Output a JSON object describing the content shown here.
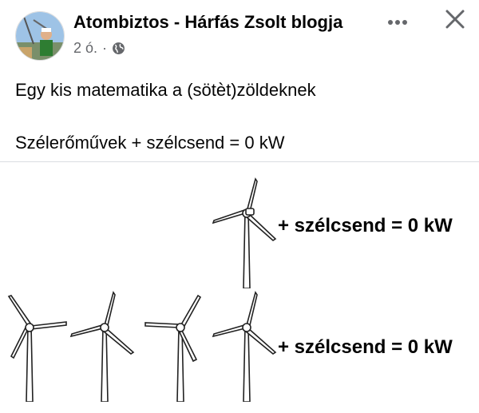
{
  "post": {
    "author": "Atombiztos - Hárfás Zsolt blogja",
    "time": "2 ó.",
    "separator": "·",
    "text_line1": "Egy kis matematika a (sötèt)zöldeknek",
    "text_line2": "Szélerőművek + szélcsend = 0 kW"
  },
  "icons": {
    "more": "more-dots-icon",
    "close": "close-icon",
    "audience": "globe-icon"
  },
  "image": {
    "caption_top": "+ szélcsend = 0 kW",
    "caption_bottom": "+ szélcsend = 0 kW"
  },
  "colors": {
    "text": "#050505",
    "meta": "#65676b",
    "divider": "#dadde1"
  }
}
